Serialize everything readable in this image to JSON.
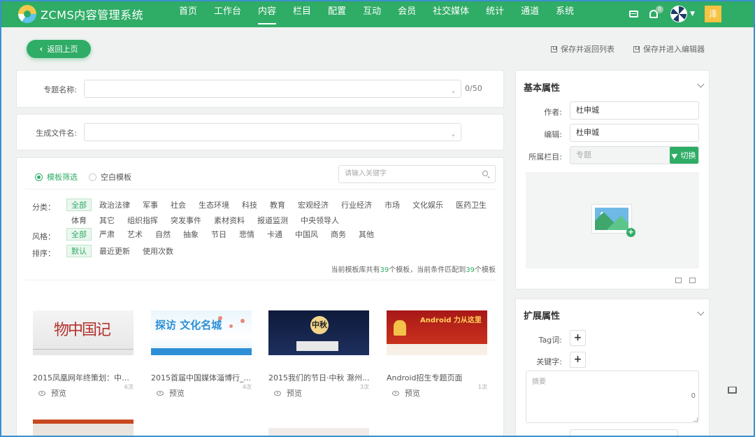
{
  "app": {
    "title": "ZCMS内容管理系统"
  },
  "nav": {
    "items": [
      "首页",
      "工作台",
      "内容",
      "栏目",
      "配置",
      "互动",
      "会员",
      "社交媒体",
      "统计",
      "通道",
      "系统"
    ],
    "active": 2,
    "notification_count": "0",
    "user_initial": "泽"
  },
  "actions": {
    "back": "返回上页",
    "save_return": "保存并返回列表",
    "save_editor": "保存并进入编辑器"
  },
  "form": {
    "topic_name_label": "专题名称:",
    "topic_name_value": "",
    "topic_name_counter": "0/50",
    "filename_label": "生成文件名:",
    "filename_value": ""
  },
  "templates": {
    "radio_filter": "模板筛选",
    "radio_blank": "空白模板",
    "search_placeholder": "请输入关键字",
    "category_label": "分类：",
    "categories": [
      "全部",
      "政治法律",
      "军事",
      "社会",
      "生态环境",
      "科技",
      "教育",
      "宏观经济",
      "行业经济",
      "市场",
      "文化娱乐",
      "医药卫生",
      "体育",
      "其它",
      "组织指挥",
      "突发事件",
      "素材资料",
      "报道监测",
      "中央领导人"
    ],
    "style_label": "风格：",
    "styles": [
      "全部",
      "严肃",
      "艺术",
      "自然",
      "抽象",
      "节日",
      "悲情",
      "卡通",
      "中国风",
      "商务",
      "其他"
    ],
    "sort_label": "排序：",
    "sorts": [
      "默认",
      "最近更新",
      "使用次数"
    ],
    "stat_prefix": "当前模板库共有",
    "stat_total": "39",
    "stat_mid": "个模板，当前条件匹配到",
    "stat_match": "39",
    "stat_suffix": "个模板",
    "preview_label": "预览",
    "items": [
      {
        "title": "2015凤凰网年终策划：中国...",
        "uses": "6次"
      },
      {
        "title": "2015首届中国媒体淄博行_...",
        "uses": "4次"
      },
      {
        "title": "2015我们的节日·中秋 滁州...",
        "uses": "3次"
      },
      {
        "title": "Android招生专题页面",
        "uses": "1次"
      }
    ],
    "thumb_texts": [
      "物中国记",
      "探访 文化名城",
      "中秋",
      "Android 力从这里"
    ]
  },
  "basic": {
    "title": "基本属性",
    "author_label": "作者:",
    "author_value": "杜申城",
    "editor_label": "编辑:",
    "editor_value": "杜申城",
    "column_label": "所属栏目:",
    "column_value": "专题",
    "switch_label": "切换"
  },
  "extended": {
    "title": "扩展属性",
    "tag_label": "Tag词:",
    "keyword_label": "关键字:",
    "summary_placeholder": "摘要",
    "summary_count": "0"
  },
  "colors": {
    "primary": "#2fac66",
    "frame": "#3b8fd0"
  }
}
